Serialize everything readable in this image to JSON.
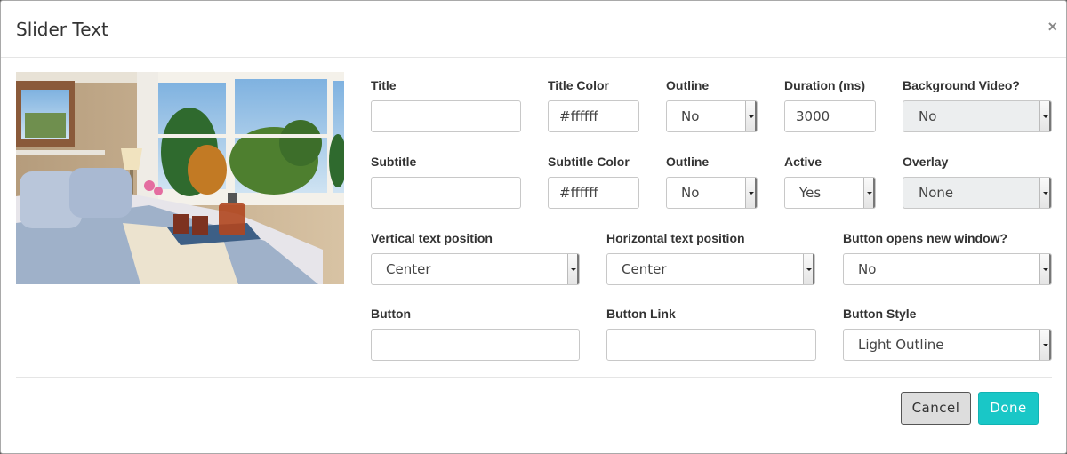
{
  "dialog": {
    "title": "Slider Text",
    "close": "×"
  },
  "fields": {
    "title": {
      "label": "Title",
      "value": ""
    },
    "title_color": {
      "label": "Title Color",
      "value": "#ffffff"
    },
    "title_outline": {
      "label": "Outline",
      "value": "No"
    },
    "duration": {
      "label": "Duration (ms)",
      "value": "3000"
    },
    "background_video": {
      "label": "Background Video?",
      "value": "No"
    },
    "subtitle": {
      "label": "Subtitle",
      "value": ""
    },
    "subtitle_color": {
      "label": "Subtitle Color",
      "value": "#ffffff"
    },
    "subtitle_outline": {
      "label": "Outline",
      "value": "No"
    },
    "active": {
      "label": "Active",
      "value": "Yes"
    },
    "overlay": {
      "label": "Overlay",
      "value": "None"
    },
    "vertical_position": {
      "label": "Vertical text position",
      "value": "Center"
    },
    "horizontal_position": {
      "label": "Horizontal text position",
      "value": "Center"
    },
    "new_window": {
      "label": "Button opens new window?",
      "value": "No"
    },
    "button": {
      "label": "Button",
      "value": ""
    },
    "button_link": {
      "label": "Button Link",
      "value": ""
    },
    "button_style": {
      "label": "Button Style",
      "value": "Light Outline"
    }
  },
  "footer": {
    "cancel": "Cancel",
    "done": "Done"
  }
}
